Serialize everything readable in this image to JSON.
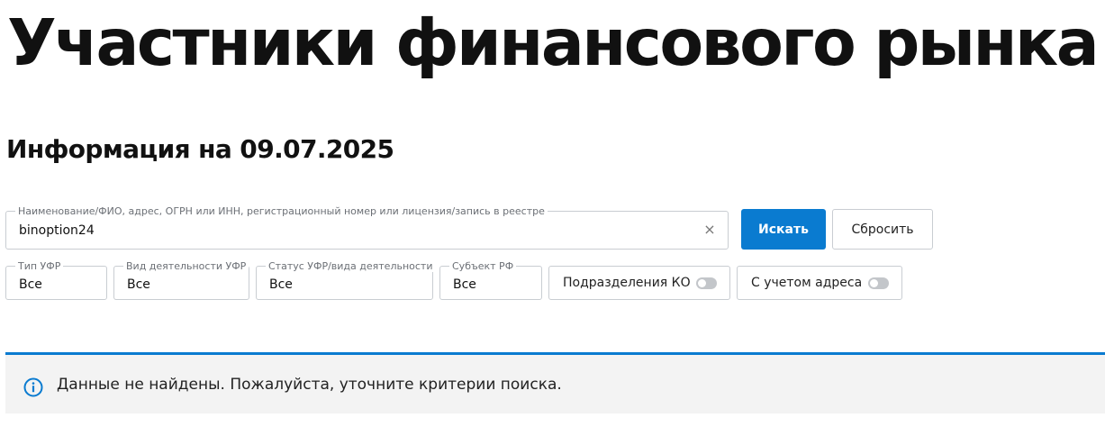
{
  "page": {
    "title": "Участники финансового рынка",
    "info_date": "Информация на 09.07.2025"
  },
  "search": {
    "legend": "Наименование/ФИО, адрес, ОГРН или ИНН, регистрационный номер или лицензия/запись в реестре",
    "value": "binoption24",
    "clear_symbol": "×",
    "search_label": "Искать",
    "reset_label": "Сбросить"
  },
  "filters": [
    {
      "legend": "Тип УФР",
      "value": "Все"
    },
    {
      "legend": "Вид деятельности УФР",
      "value": "Все"
    },
    {
      "legend": "Статус УФР/вида деятельности",
      "value": "Все"
    },
    {
      "legend": "Субъект РФ",
      "value": "Все"
    }
  ],
  "toggles": [
    {
      "label": "Подразделения КО",
      "on": false
    },
    {
      "label": "С учетом адреса",
      "on": false
    }
  ],
  "notice": {
    "text": "Данные не найдены. Пожалуйста, уточните критерии поиска.",
    "icon": "info-icon"
  },
  "colors": {
    "accent": "#0a7bd0",
    "notice_bg": "#f3f3f3",
    "border": "#c9cdd2"
  }
}
